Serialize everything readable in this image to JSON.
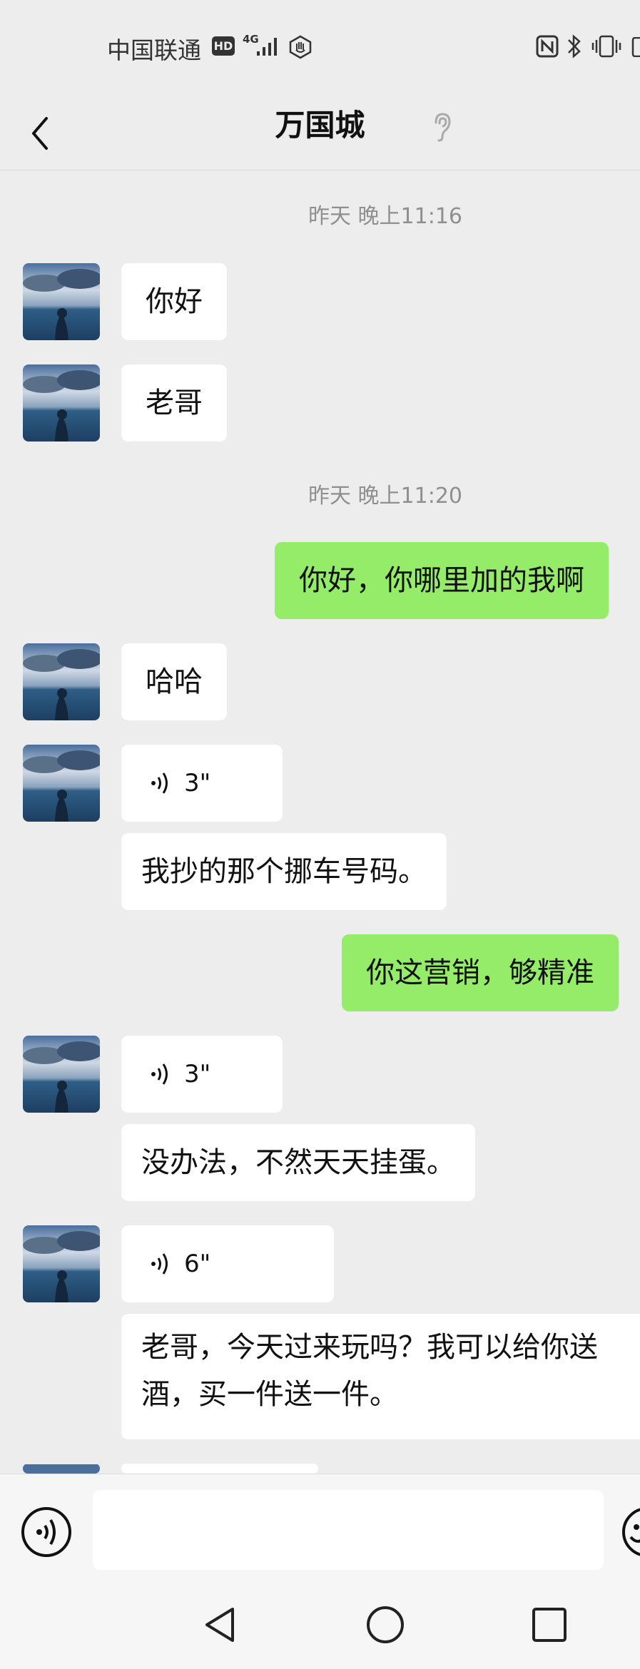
{
  "status_bar": {
    "carrier": "中国联通",
    "hd_badge": "HD",
    "network": "4G",
    "icons": [
      "signal-icon",
      "hand-icon",
      "nfc-icon",
      "bluetooth-icon",
      "vibrate-icon",
      "battery-icon"
    ]
  },
  "header": {
    "title": "万国城",
    "back_icon": "back-arrow-icon",
    "mute_icon": "ear-icon"
  },
  "messages": {
    "ts1": "昨天 晚上11:16",
    "m1": "你好",
    "m2": "老哥",
    "ts2": "昨天 晚上11:20",
    "m3": "你好，你哪里加的我啊",
    "m4": "哈哈",
    "v1": "3\"",
    "m5": "我抄的那个挪车号码。",
    "m6": "你这营销，够精准",
    "v2": "3\"",
    "m7": "没办法，不然天天挂蛋。",
    "v3": "6\"",
    "m8": "老哥，今天过来玩吗？我可以给你送酒，买一件送一件。"
  },
  "input_bar": {
    "voice_icon": "voice-toggle-icon",
    "emoji_icon": "emoji-icon",
    "value": ""
  },
  "system_nav": [
    "back-triangle-icon",
    "home-circle-icon",
    "recents-square-icon"
  ],
  "colors": {
    "background": "#ededed",
    "own_bubble": "#95ec69",
    "other_bubble": "#ffffff",
    "timestamp": "#8f8f8f"
  }
}
